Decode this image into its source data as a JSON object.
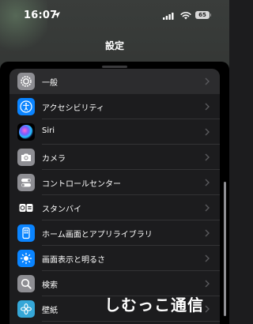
{
  "status_bar": {
    "time": "16:07",
    "battery_level": "65"
  },
  "nav": {
    "title": "設定"
  },
  "settings": {
    "items": [
      {
        "label": "一般",
        "icon": "gear-icon",
        "icon_bg": "#8e8e93",
        "selected": true
      },
      {
        "label": "アクセシビリティ",
        "icon": "accessibility-icon",
        "icon_bg": "#0a84ff"
      },
      {
        "label": "Siri",
        "icon": "siri-icon",
        "icon_bg": "#000000"
      },
      {
        "label": "カメラ",
        "icon": "camera-icon",
        "icon_bg": "#8e8e93"
      },
      {
        "label": "コントロールセンター",
        "icon": "toggles-icon",
        "icon_bg": "#8e8e93"
      },
      {
        "label": "スタンバイ",
        "icon": "standby-icon",
        "icon_bg": "#1c1c1e"
      },
      {
        "label": "ホーム画面とアプリライブラリ",
        "icon": "home-screen-icon",
        "icon_bg": "#0a84ff"
      },
      {
        "label": "画面表示と明るさ",
        "icon": "brightness-icon",
        "icon_bg": "#0a84ff"
      },
      {
        "label": "検索",
        "icon": "search-icon",
        "icon_bg": "#8e8e93"
      },
      {
        "label": "壁紙",
        "icon": "wallpaper-icon",
        "icon_bg": "#35a7d8"
      }
    ]
  },
  "watermark": {
    "text": "しむっこ通信"
  }
}
